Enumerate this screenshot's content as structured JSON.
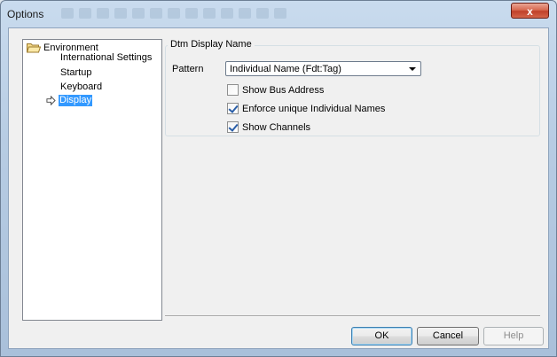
{
  "window": {
    "title": "Options",
    "close_label": "x"
  },
  "tree": {
    "root": {
      "label": "Environment"
    },
    "children": [
      {
        "label": "International Settings"
      },
      {
        "label": "Startup"
      },
      {
        "label": "Keyboard"
      },
      {
        "label": "Display",
        "selected": true
      }
    ]
  },
  "panel": {
    "group_title": "Dtm Display Name",
    "pattern_label": "Pattern",
    "pattern_value": "Individual Name (Fdt:Tag)",
    "checkboxes": [
      {
        "label": "Show Bus Address",
        "checked": false
      },
      {
        "label": "Enforce unique Individual Names",
        "checked": true
      },
      {
        "label": "Show Channels",
        "checked": true
      }
    ]
  },
  "buttons": {
    "ok": "OK",
    "cancel": "Cancel",
    "help": "Help"
  }
}
